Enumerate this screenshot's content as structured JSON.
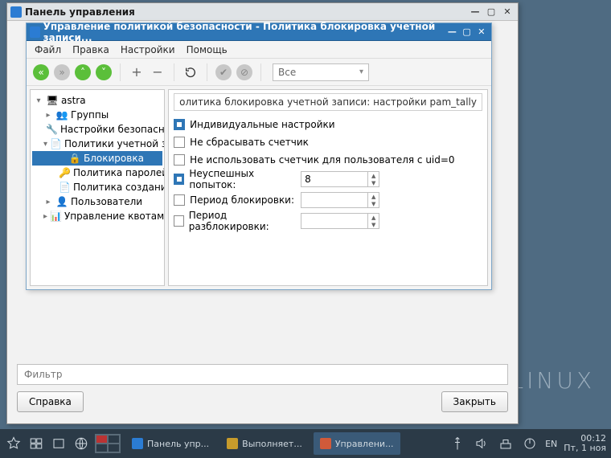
{
  "outer_window": {
    "title": "Панель управления"
  },
  "inner_window": {
    "title": "Управление политикой безопасности - Политика блокировка учетной записи...",
    "menu": {
      "file": "Файл",
      "edit": "Правка",
      "settings": "Настройки",
      "help": "Помощь"
    },
    "toolbar": {
      "filter_combo": "Все"
    },
    "tree": {
      "root": "astra",
      "groups": "Группы",
      "security_settings": "Настройки безопасности",
      "account_policies": "Политики учетной записи",
      "lockout": "Блокировка",
      "password_policy": "Политика паролей",
      "creation_policy": "Политика создания пол...",
      "users": "Пользователи",
      "quotas": "Управление квотами"
    },
    "right": {
      "heading": "олитика блокировка учетной записи: настройки pam_tally",
      "individual": "Индивидуальные настройки",
      "no_reset": "Не сбрасывать счетчик",
      "no_uid0": "Не использовать счетчик для пользователя с uid=0",
      "failed_attempts": "Неуспешных попыток:",
      "failed_attempts_value": "8",
      "lock_period": "Период блокировки:",
      "unlock_period": "Период разблокировки:"
    }
  },
  "outer_footer": {
    "filter_placeholder": "Фильтр",
    "help_btn": "Справка",
    "close_btn": "Закрыть"
  },
  "desktop": {
    "watermark": "LINUX"
  },
  "taskbar": {
    "item1": "Панель упр...",
    "item2": "Выполняет...",
    "item3": "Управлени...",
    "lang": "EN",
    "time": "00:12",
    "date": "Пт, 1 ноя"
  }
}
